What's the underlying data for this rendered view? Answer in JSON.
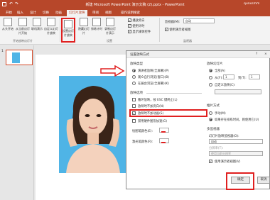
{
  "title": {
    "text": "新建 Microsoft PowerPoint 演示文稿 (2).pptx - PowerPoint",
    "user": "qunxsmm",
    "controls": [
      "?",
      "—",
      "□",
      "×"
    ]
  },
  "tabs": [
    "开始",
    "插入",
    "设计",
    "切换",
    "动画",
    "幻灯片放映",
    "审阅",
    "视图",
    "操作说明搜索"
  ],
  "ribbon": {
    "buttons": [
      "从头开始",
      "从当前幻灯片开始",
      "联机演示",
      "自定义幻灯片放映",
      "设置幻灯片放映",
      "隐藏幻灯片",
      "排练计时",
      "录制幻灯片演示"
    ],
    "checks": [
      "播放旁白",
      "使用计时",
      "显示媒体控件"
    ],
    "monitor_label": "监视器(M):",
    "monitor_value": "自动",
    "presenter_view": "使用演示者视图",
    "groups": [
      "开始放映幻灯片",
      "设置",
      "监视器"
    ]
  },
  "dialog": {
    "title": "设置放映方式",
    "help": "?",
    "close": "×",
    "show_type": {
      "label": "放映类型",
      "options": [
        "演讲者放映(全屏幕)(P)",
        "观众自行浏览(窗口)(B)",
        "在展台浏览(全屏幕)(K)"
      ],
      "selected": 0
    },
    "show_options": {
      "label": "放映选项",
      "items": [
        {
          "text": "循环放映，按 ESC 键终止(L)",
          "checked": false
        },
        {
          "text": "放映时不加旁白(N)",
          "checked": false
        },
        {
          "text": "放映时不加动画(S)",
          "checked": true
        },
        {
          "text": "禁用硬件图形加速(G)",
          "checked": false
        }
      ]
    },
    "pen_color": "绘图笔颜色(E):",
    "laser_color": "激光笔颜色(R):",
    "slides": {
      "label": "放映幻灯片",
      "all": "全部(A)",
      "from": "从(F):",
      "from_value": "1",
      "to": "到(T):",
      "to_value": "1",
      "custom": "自定义放映(C):"
    },
    "advance": {
      "label": "推片方式",
      "manual": "手动(M)",
      "timing": "如果存在排练时间，则使用它(U)"
    },
    "multi_monitor": {
      "label": "多监视器",
      "show_on": "幻灯片放映监视器(O):",
      "show_on_value": "自动",
      "resolution": "分辨率(T):",
      "resolution_value": "使用当前分辨率",
      "presenter": "使用演示者视图(V)"
    },
    "ok": "确定",
    "cancel": "取消"
  },
  "thumbnail_number": "1",
  "colors": {
    "accent": "#b7472a",
    "highlight": "#e02020"
  }
}
